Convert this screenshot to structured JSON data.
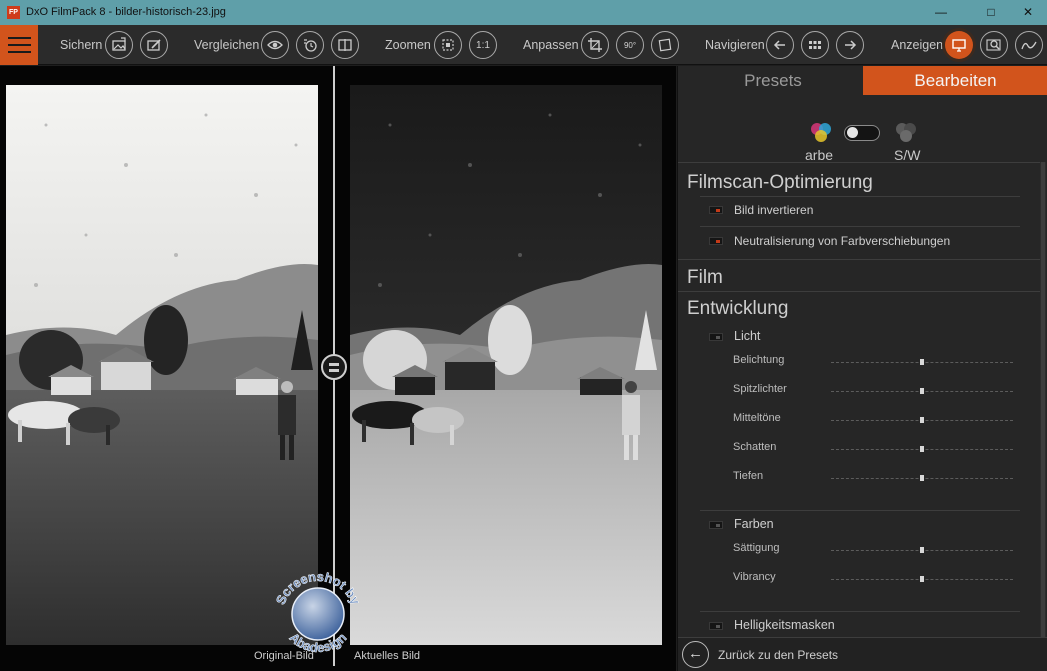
{
  "window": {
    "title": "DxO FilmPack 8 - bilder-historisch-23.jpg",
    "logo_text": "FP",
    "minimize_glyph": "—",
    "maximize_glyph": "□",
    "close_glyph": "✕"
  },
  "toolbar": {
    "groups": [
      {
        "label": "Sichern",
        "buttons": [
          "export-image-icon",
          "export-edit-icon"
        ]
      },
      {
        "label": "Vergleichen",
        "buttons": [
          "eye-icon",
          "history-icon"
        ]
      },
      {
        "label": "Zoomen",
        "buttons": [
          "fit-icon",
          "zoom-1-1-icon"
        ]
      },
      {
        "label": "Anpassen",
        "buttons": [
          "crop-icon",
          "rotate-90-icon",
          "straighten-icon"
        ]
      },
      {
        "label": "Navigieren",
        "buttons": [
          "arrow-left-icon",
          "grid-icon",
          "arrow-right-icon"
        ]
      },
      {
        "label": "Anzeigen",
        "buttons": [
          "display-icon",
          "loupe-icon",
          "histogram-icon"
        ]
      }
    ],
    "zoom_label": "1:1",
    "rotate_label": "90°"
  },
  "viewer": {
    "left_caption": "Original-Bild",
    "right_caption": "Aktuelles Bild",
    "watermark_top": "Screenshot by",
    "watermark_bottom": "Abadesign"
  },
  "panel": {
    "tabs": [
      {
        "label": "Presets",
        "active": false
      },
      {
        "label": "Bearbeiten",
        "active": true
      }
    ],
    "mode_color_label": "arbe",
    "mode_bw_label": "S/W",
    "sections": {
      "filmscan": {
        "title": "Filmscan-Optimierung",
        "items": [
          "Bild invertieren",
          "Neutralisierung von Farbverschiebungen"
        ]
      },
      "film": {
        "title": "Film"
      },
      "entwicklung": {
        "title": "Entwicklung",
        "licht": {
          "label": "Licht",
          "sliders": [
            {
              "label": "Belichtung",
              "value": 0
            },
            {
              "label": "Spitzlichter",
              "value": 0
            },
            {
              "label": "Mitteltöne",
              "value": 0
            },
            {
              "label": "Schatten",
              "value": 0
            },
            {
              "label": "Tiefen",
              "value": 0
            }
          ]
        },
        "farben": {
          "label": "Farben",
          "sliders": [
            {
              "label": "Sättigung",
              "value": 0
            },
            {
              "label": "Vibrancy",
              "value": 0
            }
          ]
        },
        "masken_label": "Helligkeitsmasken"
      }
    },
    "back_label": "Zurück zu den Presets"
  },
  "colors": {
    "accent": "#d2541c",
    "titlebar": "#5f9fa9",
    "panel_bg": "#262626"
  }
}
